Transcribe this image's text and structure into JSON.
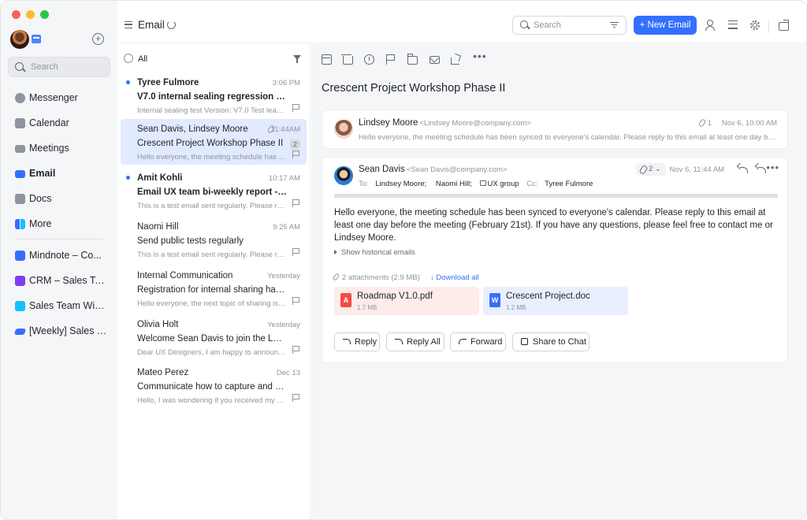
{
  "sidebar": {
    "search_placeholder": "Search",
    "items": [
      {
        "label": "Messenger",
        "icon": "messenger-icon",
        "color": "#8f959e"
      },
      {
        "label": "Calendar",
        "icon": "calendar-icon",
        "color": "#8f959e"
      },
      {
        "label": "Meetings",
        "icon": "video-icon",
        "color": "#8f959e"
      },
      {
        "label": "Email",
        "icon": "mail-icon",
        "color": "#3370ff"
      },
      {
        "label": "Docs",
        "icon": "docs-icon",
        "color": "#8f959e"
      },
      {
        "label": "More",
        "icon": "apps-icon",
        "color": "#3370ff"
      }
    ],
    "pinned": [
      {
        "label": "Mindnote – Co...",
        "icon": "mindnote-icon",
        "color": "#3370ff"
      },
      {
        "label": "CRM – Sales Te...",
        "icon": "crm-icon",
        "color": "#7f3bf5"
      },
      {
        "label": "Sales Team Wiki...",
        "icon": "wiki-icon",
        "color": "#14c0ff"
      },
      {
        "label": "[Weekly] Sales T...",
        "icon": "weekly-icon",
        "color": "#3370ff"
      }
    ]
  },
  "header": {
    "title": "Email",
    "search_placeholder": "Search",
    "new_email_label": "+ New Email"
  },
  "list": {
    "all_label": "All",
    "emails": [
      {
        "sender": "Tyree Fulmore",
        "time": "3:06 PM",
        "subject": "V7.0 internal sealing regression test rep...",
        "preview": "Internal sealing test Version: V7.0 Test leader...",
        "unread": true
      },
      {
        "sender": "Sean Davis, Lindsey Moore",
        "time": "11:44AM",
        "subject": "Crescent Project Workshop Phase II",
        "preview": "Hello everyone, the meeting schedule has be...",
        "count": "2",
        "selected": true
      },
      {
        "sender": "Amit Kohli",
        "time": "10:17 AM",
        "subject": "Email UX team bi-weekly report - 2023/...",
        "preview": "This is a test email sent regularly. Please repl...",
        "unread": true
      },
      {
        "sender": "Naomi Hill",
        "time": "9:25 AM",
        "subject": "Send public tests regularly",
        "preview": "This is a test email sent regularly. Please repl..."
      },
      {
        "sender": "Internal Communication",
        "time": "Yesterday",
        "subject": "Registration for internal sharing has starte...",
        "preview": "Hello everyone, the next topic of sharing is m..."
      },
      {
        "sender": "Olivia Holt",
        "time": "Yesterday",
        "subject": "Welcome Sean Davis to join the Lark UX t...",
        "preview": "Dear UX Designers, I am happy to announce..."
      },
      {
        "sender": "Mateo Perez",
        "time": "Dec 13",
        "subject": "Communicate how to capture and archive...",
        "preview": "Hello, I was wondering if you received my pr..."
      }
    ]
  },
  "thread": {
    "subject": "Crescent Project Workshop Phase II",
    "msg1": {
      "name": "Lindsey Moore",
      "address": "<Lindsey Moore@company.com>",
      "attachments": "1",
      "time": "Nov 6, 10:00 AM",
      "preview": "Hello everyone, the meeting schedule has been synced to everyone's calendar. Please reply to this email at least one day before t..."
    },
    "msg2": {
      "name": "Sean Davis",
      "address": "<Sean Davis@company.com>",
      "attachments": "2",
      "time": "Nov 6, 11:44 AM",
      "to_label": "To:",
      "to": [
        "Lindsey Moore;",
        "Naomi Hill;",
        "UX group"
      ],
      "cc_label": "Cc:",
      "cc": "Tyree Fulmore",
      "body": "Hello everyone, the meeting schedule has been synced to everyone's calendar. Please reply to this email at least one day before the meeting (February 21st). If you have any questions, please feel free to contact me or Lindsey Moore.",
      "history": "Show historical emails",
      "attach_summary": "2 attachments",
      "attach_size": "(2.9 MB)",
      "download_all": "Download all",
      "files": [
        {
          "name": "Roadmap V1.0.pdf",
          "size": "1.7 MB",
          "badge": "A"
        },
        {
          "name": "Crescent Project.doc",
          "size": "1.2 MB",
          "badge": "W"
        }
      ],
      "buttons": {
        "reply": "Reply",
        "reply_all": "Reply All",
        "forward": "Forward",
        "share": "Share to Chat"
      }
    }
  },
  "colors": {
    "accent": "#3370ff",
    "selected_row": "#e1eaff"
  }
}
